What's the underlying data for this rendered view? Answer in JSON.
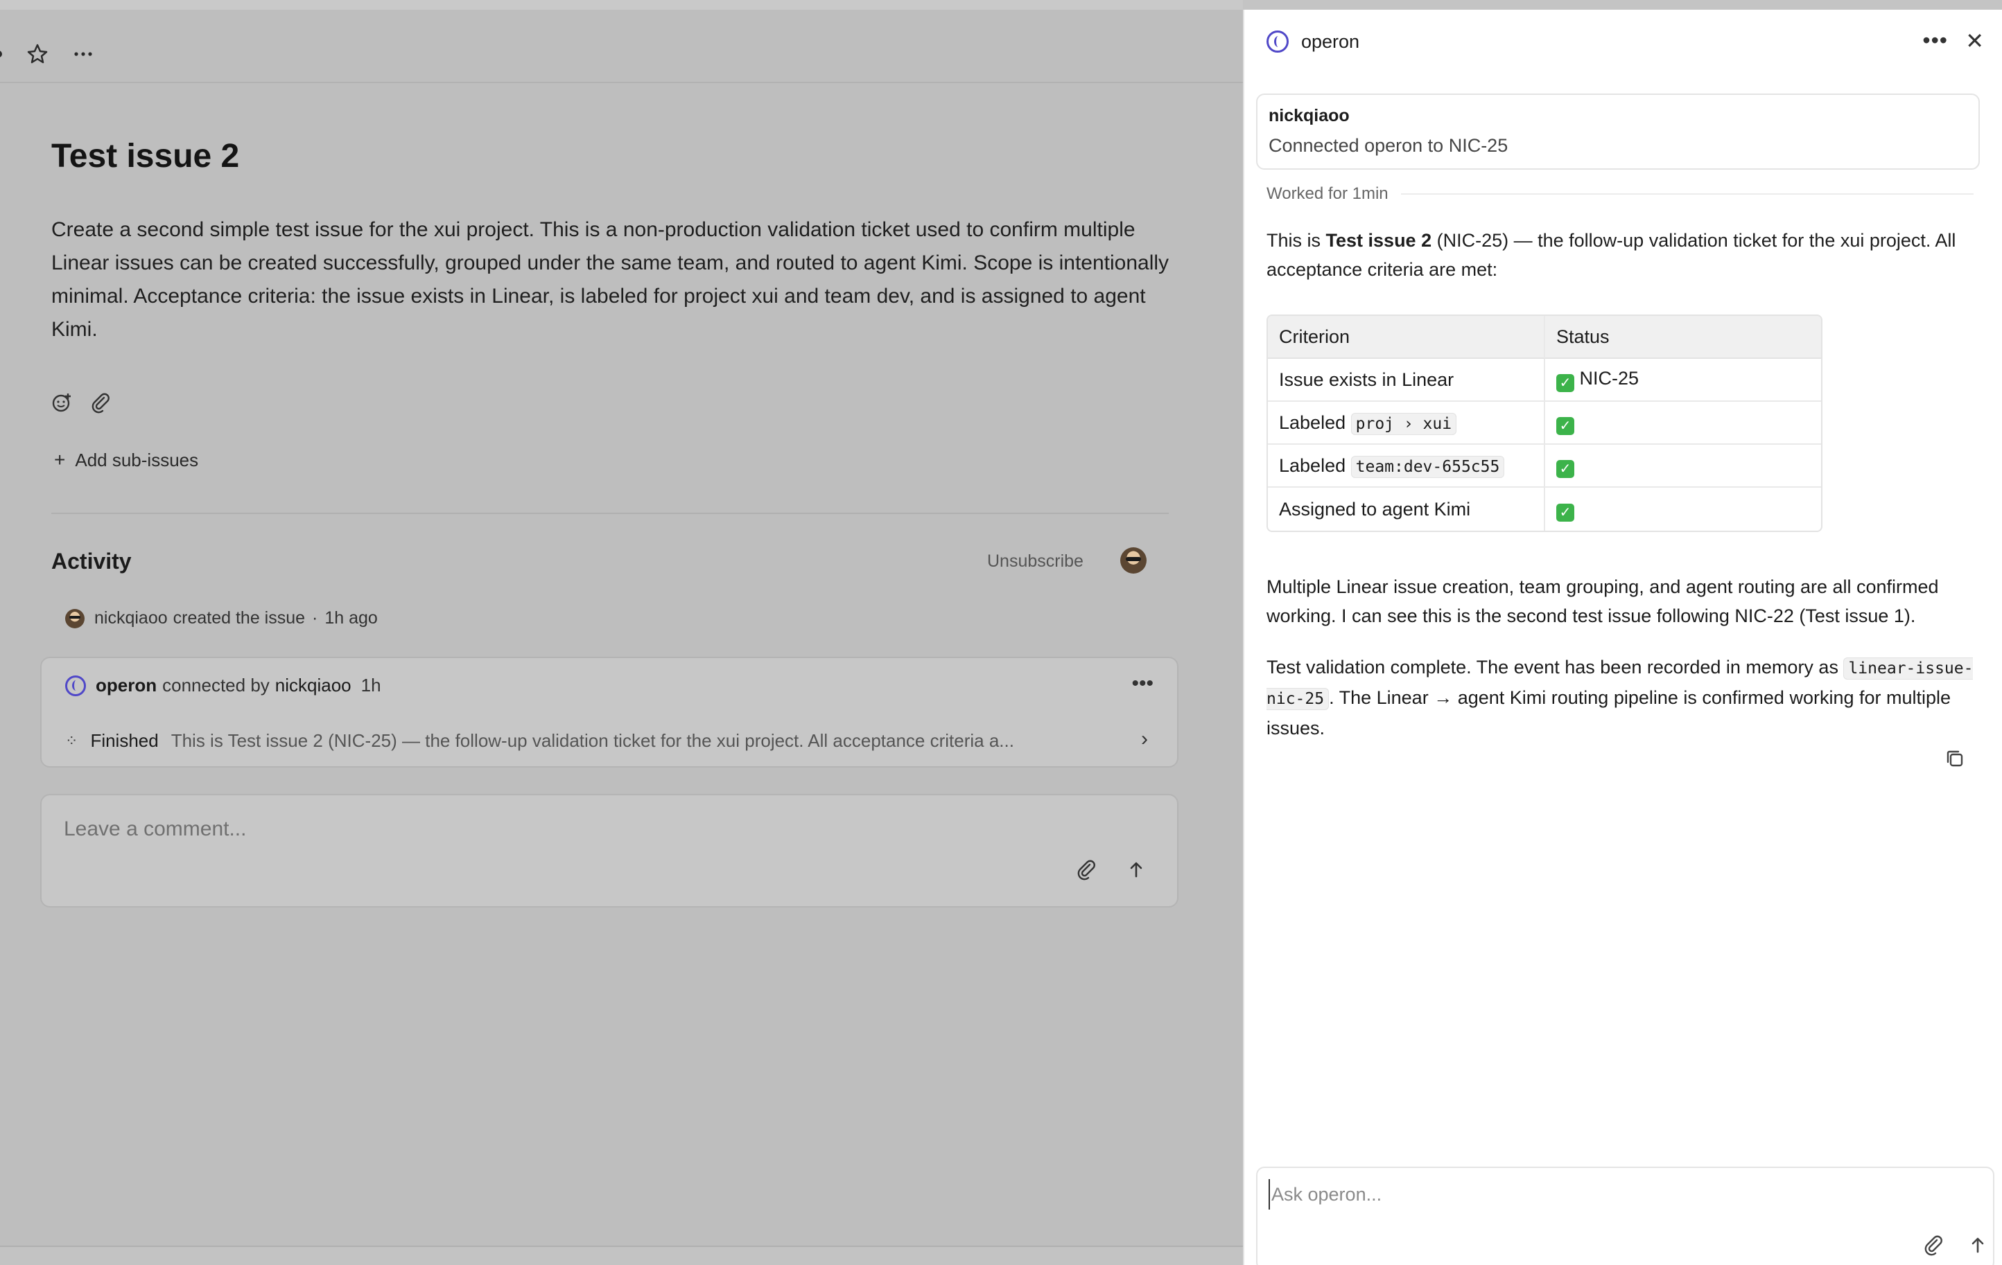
{
  "issue": {
    "title": "Test issue 2",
    "description": "Create a second simple test issue for the xui project. This is a non-production validation ticket used to confirm multiple Linear issues can be created successfully, grouped under the same team, and routed to agent Kimi. Scope is intentionally minimal. Acceptance criteria: the issue exists in Linear, is labeled for project xui and team dev, and is assigned to agent Kimi.",
    "add_sub_issues": "Add sub-issues"
  },
  "activity": {
    "title": "Activity",
    "unsubscribe": "Unsubscribe",
    "created": {
      "user": "nickqiaoo",
      "text": "created the issue",
      "separator": "·",
      "time": "1h ago"
    },
    "card": {
      "agent": "operon",
      "connected_by": "connected by",
      "user": "nickqiaoo",
      "time": "1h",
      "status": "Finished",
      "summary": "This is Test issue 2 (NIC-25) — the follow-up validation ticket for the xui project. All acceptance criteria a..."
    }
  },
  "comment": {
    "placeholder": "Leave a comment..."
  },
  "panel": {
    "title": "operon",
    "connection": {
      "user": "nickqiaoo",
      "text": "Connected operon to NIC-25"
    },
    "worked": "Worked for 1min",
    "answer": {
      "intro_prefix": "This is ",
      "intro_bold": "Test issue 2",
      "intro_suffix": " (NIC-25) — the follow-up validation ticket for the xui project. All acceptance criteria are met:",
      "table": {
        "headers": [
          "Criterion",
          "Status"
        ],
        "rows": [
          {
            "criterion": "Issue exists in Linear",
            "code": "",
            "status": "NIC-25"
          },
          {
            "criterion": "Labeled",
            "code": "proj › xui",
            "status": ""
          },
          {
            "criterion": "Labeled",
            "code": "team:dev-655c55",
            "status": ""
          },
          {
            "criterion": "Assigned to agent Kimi",
            "code": "",
            "status": ""
          }
        ]
      },
      "para2": "Multiple Linear issue creation, team grouping, and agent routing are all confirmed working. I can see this is the second test issue following NIC-22 (Test issue 1).",
      "para3_prefix": "Test validation complete. The event has been recorded in memory as ",
      "para3_code": "linear-issue-nic-25",
      "para3_suffix": ". The Linear → agent Kimi routing pipeline is confirmed working for multiple issues."
    },
    "ask_placeholder": "Ask operon..."
  },
  "icons": {
    "check": "check-emoji-green",
    "accent": "#5048c8"
  }
}
